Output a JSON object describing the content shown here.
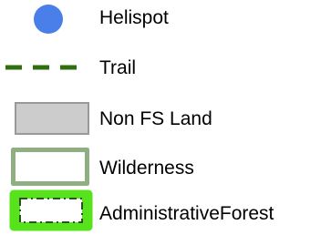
{
  "legend": {
    "items": [
      {
        "label": "Helispot",
        "symbol": "helispot-icon",
        "color": "#4a7ee8"
      },
      {
        "label": "Trail",
        "symbol": "trail-line-icon",
        "color": "#2f6f10"
      },
      {
        "label": "Non FS Land",
        "symbol": "non-fs-land-swatch",
        "fill": "#cccccc",
        "stroke": "#999999"
      },
      {
        "label": "Wilderness",
        "symbol": "wilderness-swatch",
        "fill": "#ffffff",
        "stroke": "#8fae82"
      },
      {
        "label": "AdministrativeForest",
        "symbol": "administrative-forest-swatch",
        "fill": "#ffffff",
        "stroke": "#57e31b",
        "inner_stroke": "#1f3d12"
      }
    ]
  }
}
